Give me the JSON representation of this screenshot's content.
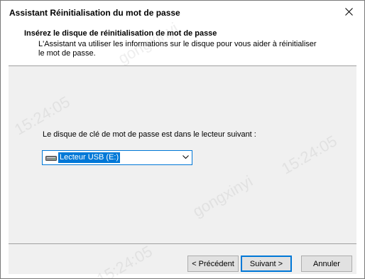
{
  "window": {
    "title": "Assistant Réinitialisation du mot de passe"
  },
  "header": {
    "title": "Insérez le disque de réinitialisation de mot de passe",
    "description": "L'Assistant va utiliser les informations sur le disque pour vous aider à réinitialiser le mot de passe."
  },
  "main": {
    "drive_label": "Le disque de clé de mot de passe est dans le lecteur suivant :",
    "drive_select": {
      "value": "Lecteur USB (E:)",
      "icon": "usb-drive-icon"
    }
  },
  "footer": {
    "back_label": "< Précédent",
    "next_label": "Suivant >",
    "cancel_label": "Annuler"
  },
  "watermarks": {
    "user": "gongxinyi",
    "time": "15:24:05"
  },
  "colors": {
    "accent": "#0078d7",
    "dialog_bg": "#f0f0f0",
    "button_bg": "#e1e1e1"
  }
}
